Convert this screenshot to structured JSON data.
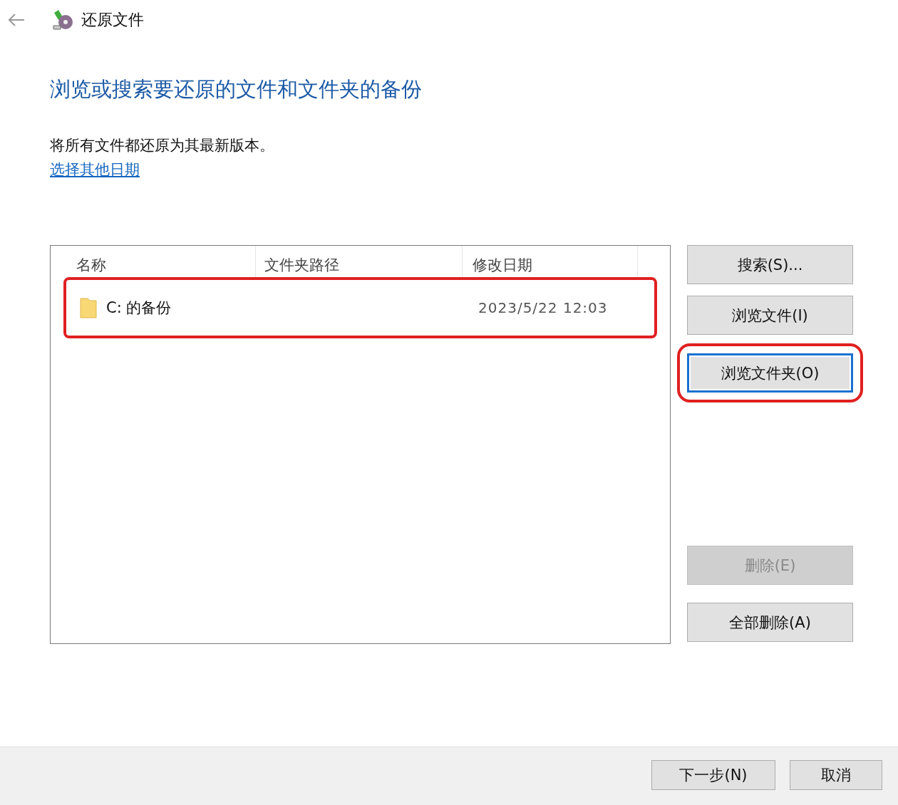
{
  "window": {
    "title": "还原文件"
  },
  "heading": "浏览或搜索要还原的文件和文件夹的备份",
  "description": "将所有文件都还原为其最新版本。",
  "link": "选择其他日期",
  "table": {
    "columns": [
      "名称",
      "文件夹路径",
      "修改日期"
    ],
    "rows": [
      {
        "name": "C: 的备份",
        "date": "2023/5/22 12:03",
        "highlighted": true
      }
    ]
  },
  "side_buttons": [
    {
      "label": "搜索(S)...",
      "disabled": false,
      "focused": false,
      "highlighted": false
    },
    {
      "label": "浏览文件(I)",
      "disabled": false,
      "focused": false,
      "highlighted": false
    },
    {
      "label": "浏览文件夹(O)",
      "disabled": false,
      "focused": true,
      "highlighted": true
    },
    {
      "label": "删除(E)",
      "disabled": true,
      "focused": false,
      "highlighted": false
    },
    {
      "label": "全部删除(A)",
      "disabled": false,
      "focused": false,
      "highlighted": false
    }
  ],
  "footer_buttons": [
    "下一步(N)",
    "取消"
  ]
}
